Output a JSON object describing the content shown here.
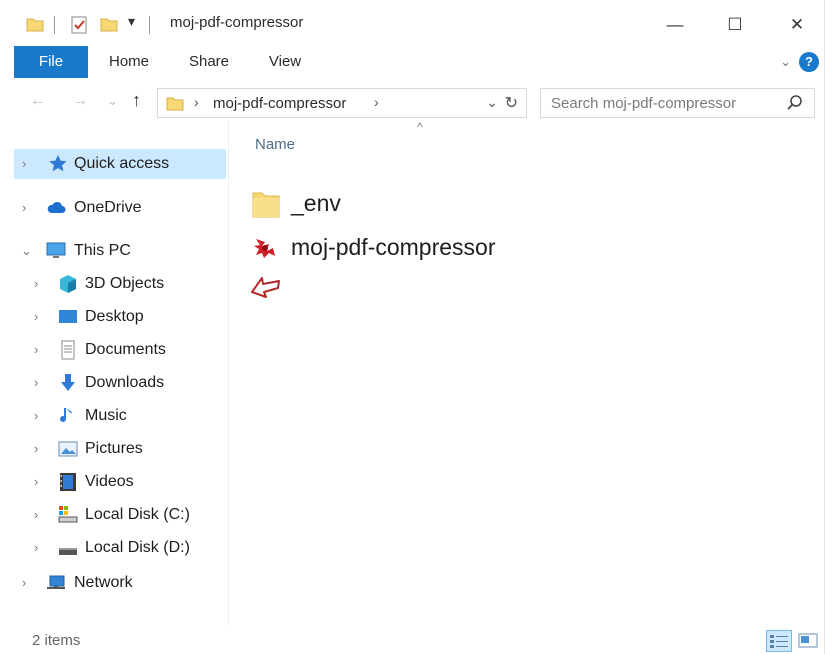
{
  "window": {
    "title": "moj-pdf-compressor",
    "minimize_glyph": "—",
    "maximize_glyph": "☐",
    "close_glyph": "✕"
  },
  "quick_access_toolbar": {
    "customize_glyph": "▾"
  },
  "ribbon": {
    "tabs": [
      {
        "label": "File"
      },
      {
        "label": "Home"
      },
      {
        "label": "Share"
      },
      {
        "label": "View"
      }
    ],
    "expand_glyph": "⌄",
    "help_label": "?"
  },
  "address": {
    "back_glyph": "←",
    "forward_glyph": "→",
    "recent_glyph": "⌄",
    "up_glyph": "↑",
    "path_label": "moj-pdf-compressor",
    "separator_glyph": "›",
    "dropdown_glyph": "⌄",
    "refresh_glyph": "↻"
  },
  "search": {
    "placeholder": "Search moj-pdf-compressor"
  },
  "nav": {
    "items": [
      {
        "label": "Quick access",
        "icon": "star-icon"
      },
      {
        "label": "OneDrive",
        "icon": "cloud-icon"
      },
      {
        "label": "This PC",
        "icon": "computer-icon"
      },
      {
        "label": "3D Objects",
        "icon": "cube-icon"
      },
      {
        "label": "Desktop",
        "icon": "desktop-icon"
      },
      {
        "label": "Documents",
        "icon": "document-icon"
      },
      {
        "label": "Downloads",
        "icon": "download-icon"
      },
      {
        "label": "Music",
        "icon": "music-icon"
      },
      {
        "label": "Pictures",
        "icon": "picture-icon"
      },
      {
        "label": "Videos",
        "icon": "video-icon"
      },
      {
        "label": "Local Disk (C:)",
        "icon": "drive-c-icon"
      },
      {
        "label": "Local Disk (D:)",
        "icon": "drive-d-icon"
      },
      {
        "label": "Network",
        "icon": "network-icon"
      }
    ],
    "collapsed_glyph": "›",
    "expanded_glyph": "⌄"
  },
  "content": {
    "sort_glyph": "^",
    "column_name": "Name",
    "files": [
      {
        "name": "_env",
        "type": "folder"
      },
      {
        "name": "moj-pdf-compressor",
        "type": "application"
      }
    ]
  },
  "status": {
    "item_count": "2 items"
  },
  "colors": {
    "accent": "#1979ca",
    "selection": "#cce8ff",
    "folder": "#f7d875",
    "annotation_arrow": "#b02a2a"
  }
}
